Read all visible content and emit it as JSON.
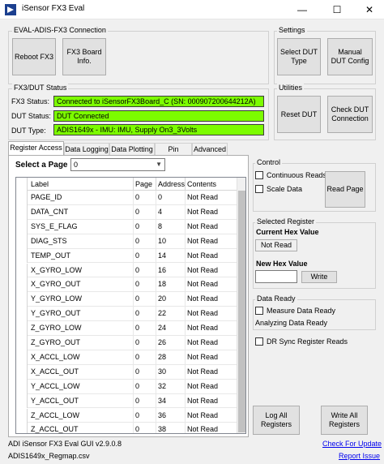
{
  "window": {
    "title": "iSensor FX3 Eval",
    "minimize_glyph": "—",
    "maximize_glyph": "☐",
    "close_glyph": "✕"
  },
  "connection": {
    "group_label": "EVAL-ADIS-FX3 Connection",
    "reboot_label": "Reboot FX3",
    "board_info_label": "FX3 Board\nInfo."
  },
  "settings": {
    "group_label": "Settings",
    "select_dut_label": "Select DUT\nType",
    "manual_dut_label": "Manual\nDUT Config"
  },
  "status": {
    "group_label": "FX3/DUT Status",
    "fx3_label": "FX3 Status:",
    "fx3_value": "Connected to iSensorFX3Board_C (SN: 000907200644212A)",
    "dut_label": "DUT Status:",
    "dut_value": "DUT Connected",
    "type_label": "DUT Type:",
    "type_value": "ADIS1649x - IMU: IMU, Supply On3_3Volts"
  },
  "utilities": {
    "group_label": "Utilities",
    "reset_label": "Reset DUT",
    "check_label": "Check DUT\nConnection"
  },
  "tabs": [
    "Register Access",
    "Data Logging",
    "Data Plotting",
    "Pin Access",
    "Advanced"
  ],
  "register_access": {
    "select_page_label": "Select a Page",
    "page_value": "0",
    "columns": [
      "Label",
      "Page",
      "Address",
      "Contents"
    ],
    "rows": [
      [
        "PAGE_ID",
        "0",
        "0",
        "Not Read"
      ],
      [
        "DATA_CNT",
        "0",
        "4",
        "Not Read"
      ],
      [
        "SYS_E_FLAG",
        "0",
        "8",
        "Not Read"
      ],
      [
        "DIAG_STS",
        "0",
        "10",
        "Not Read"
      ],
      [
        "TEMP_OUT",
        "0",
        "14",
        "Not Read"
      ],
      [
        "X_GYRO_LOW",
        "0",
        "16",
        "Not Read"
      ],
      [
        "X_GYRO_OUT",
        "0",
        "18",
        "Not Read"
      ],
      [
        "Y_GYRO_LOW",
        "0",
        "20",
        "Not Read"
      ],
      [
        "Y_GYRO_OUT",
        "0",
        "22",
        "Not Read"
      ],
      [
        "Z_GYRO_LOW",
        "0",
        "24",
        "Not Read"
      ],
      [
        "Z_GYRO_OUT",
        "0",
        "26",
        "Not Read"
      ],
      [
        "X_ACCL_LOW",
        "0",
        "28",
        "Not Read"
      ],
      [
        "X_ACCL_OUT",
        "0",
        "30",
        "Not Read"
      ],
      [
        "Y_ACCL_LOW",
        "0",
        "32",
        "Not Read"
      ],
      [
        "Y_ACCL_OUT",
        "0",
        "34",
        "Not Read"
      ],
      [
        "Z_ACCL_LOW",
        "0",
        "36",
        "Not Read"
      ],
      [
        "Z_ACCL_OUT",
        "0",
        "38",
        "Not Read"
      ]
    ]
  },
  "control": {
    "group_label": "Control",
    "continuous_label": "Continuous Reads",
    "scale_label": "Scale Data",
    "read_page_label": "Read Page"
  },
  "selected_register": {
    "group_label": "Selected Register",
    "current_hex_label": "Current Hex Value",
    "current_hex_value": "Not Read",
    "new_hex_label": "New Hex Value",
    "new_hex_value": "",
    "write_label": "Write"
  },
  "data_ready": {
    "group_label": "Data Ready",
    "measure_label": "Measure Data Ready",
    "analyzing_text": "Analyzing Data Ready",
    "dr_sync_label": "DR Sync Register Reads"
  },
  "actions": {
    "log_all_label": "Log All\nRegisters",
    "write_all_label": "Write All\nRegisters"
  },
  "footer": {
    "version": "ADI iSensor FX3 Eval GUI v2.9.0.8",
    "regmap": "ADIS1649x_Regmap.csv",
    "check_update": "Check For Update",
    "report_issue": "Report Issue"
  },
  "colors": {
    "status_green": "#7cfc00",
    "link_blue": "#0000ee",
    "button_face": "#e1e1e1",
    "app_icon": "#1b3f8f"
  }
}
